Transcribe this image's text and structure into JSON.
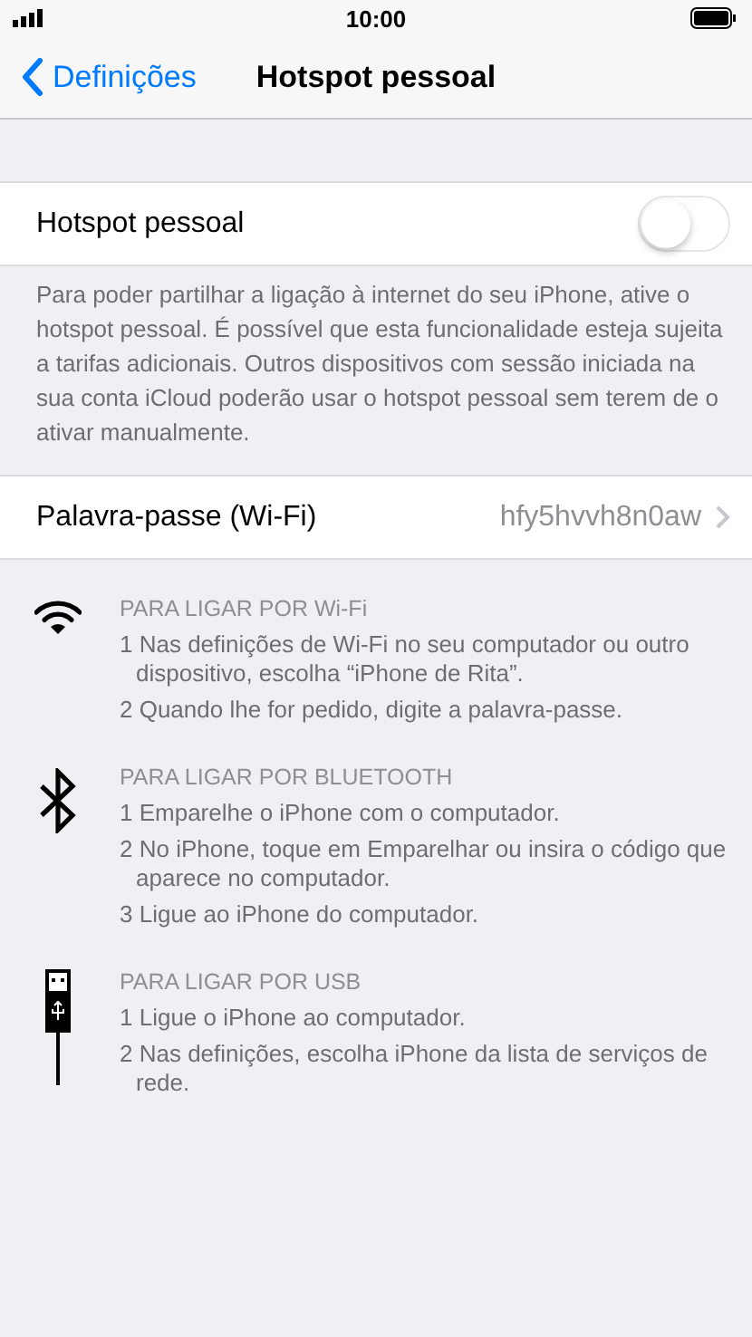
{
  "status_bar": {
    "time": "10:00"
  },
  "nav": {
    "back": "Definições",
    "title": "Hotspot pessoal"
  },
  "hotspot": {
    "label": "Hotspot pessoal",
    "on": false
  },
  "footnote": "Para poder partilhar a ligação à internet do seu iPhone, ative o hotspot pessoal. É possível que esta funcionalidade esteja sujeita a tarifas adicionais. Outros dispositivos com sessão iniciada na sua conta iCloud poderão usar o hotspot pessoal sem terem de o ativar manualmente.",
  "password": {
    "label": "Palavra-passe (Wi-Fi)",
    "value": "hfy5hvvh8n0aw"
  },
  "sections": [
    {
      "kind": "wifi",
      "heading": "PARA LIGAR POR Wi-Fi",
      "steps": [
        "1 Nas definições de Wi-Fi no seu computador ou outro dispositivo, escolha “iPhone de Rita”.",
        "2 Quando lhe for pedido, digite a palavra-passe."
      ]
    },
    {
      "kind": "bluetooth",
      "heading": "PARA LIGAR POR BLUETOOTH",
      "steps": [
        "1 Emparelhe o iPhone com o computador.",
        "2 No iPhone, toque em Emparelhar ou insira o código que aparece no computador.",
        "3 Ligue ao iPhone do computador."
      ]
    },
    {
      "kind": "usb",
      "heading": "PARA LIGAR POR USB",
      "steps": [
        "1 Ligue o iPhone ao computador.",
        "2 Nas definições, escolha iPhone da lista de serviços de rede."
      ]
    }
  ]
}
